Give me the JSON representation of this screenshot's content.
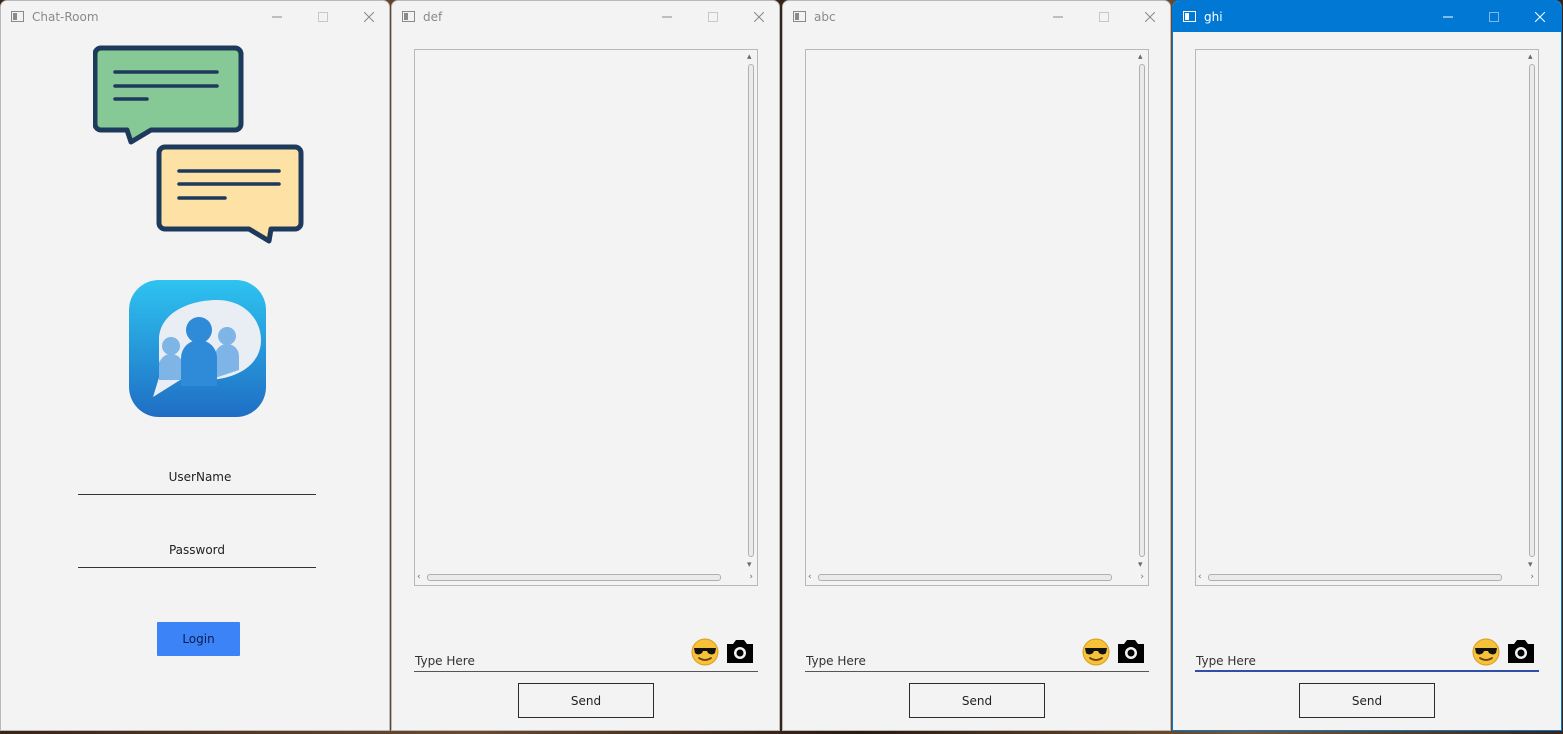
{
  "login_window": {
    "title": "Chat-Room",
    "username_label": "UserName",
    "password_label": "Password",
    "login_label": "Login",
    "login_color": "#3b83f6"
  },
  "chat_windows": [
    {
      "title": "def",
      "placeholder": "Type Here",
      "send_label": "Send",
      "active": false
    },
    {
      "title": "abc",
      "placeholder": "Type Here",
      "send_label": "Send",
      "active": false
    },
    {
      "title": "ghi",
      "placeholder": "Type Here",
      "send_label": "Send",
      "active": true
    }
  ],
  "icons": {
    "chat_bubbles": "chat-bubbles-icon",
    "app_logo": "group-chat-logo-icon",
    "emoji": "sunglasses-emoji-icon",
    "camera": "camera-icon"
  },
  "colors": {
    "active_titlebar": "#0078d4",
    "window_bg": "#f3f3f3",
    "focused_underline": "#2d4fa8"
  }
}
